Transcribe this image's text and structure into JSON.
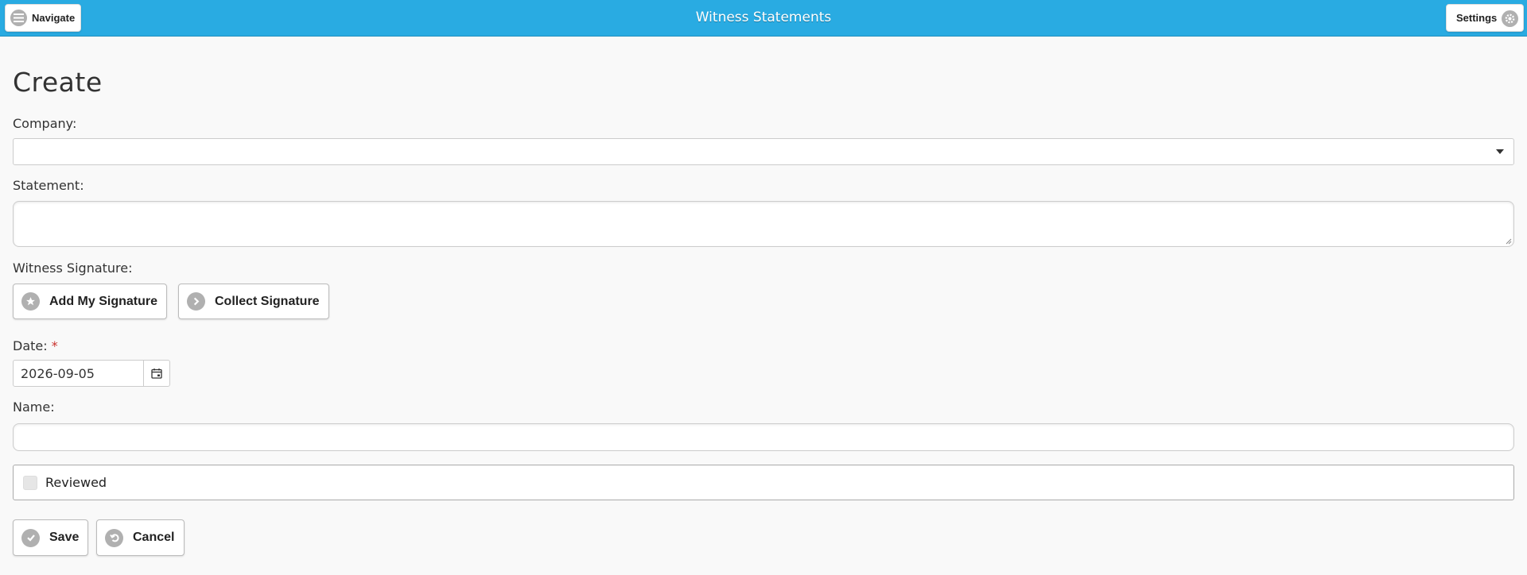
{
  "header": {
    "title": "Witness Statements",
    "navigate_label": "Navigate",
    "settings_label": "Settings",
    "accent_color": "#29abe2"
  },
  "page": {
    "title": "Create"
  },
  "form": {
    "company": {
      "label": "Company:",
      "value": ""
    },
    "statement": {
      "label": "Statement:",
      "value": ""
    },
    "witness_signature": {
      "label": "Witness Signature:",
      "add_my_signature_label": "Add My Signature",
      "collect_signature_label": "Collect Signature"
    },
    "date": {
      "label": "Date:",
      "required_marker": "*",
      "value": "2026-09-05"
    },
    "name": {
      "label": "Name:",
      "value": ""
    },
    "reviewed": {
      "label": "Reviewed",
      "checked": false
    },
    "save_label": "Save",
    "cancel_label": "Cancel"
  },
  "icons": {
    "navigate": "menu-icon",
    "settings": "gear-icon",
    "add_signature": "star-icon",
    "collect_signature": "arrow-right-icon",
    "date_picker": "calendar-icon",
    "save": "check-icon",
    "cancel": "undo-icon"
  }
}
